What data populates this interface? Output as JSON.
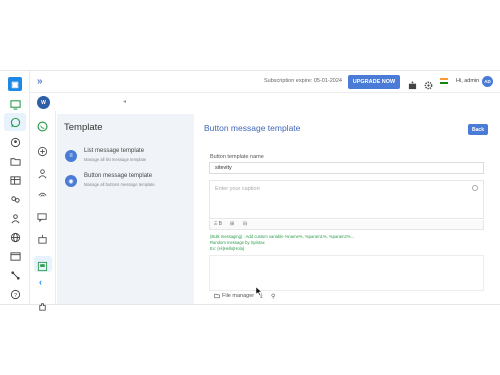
{
  "topbar": {
    "expand_icon": "»",
    "subscription": "Subscription expire: 05-01-2024",
    "upgrade_label": "UPGRADE NOW",
    "greeting": "Hi, admin",
    "avatar_initials": "AD"
  },
  "templates": {
    "title": "Template",
    "items": [
      {
        "label": "List message template",
        "sub": "Manage all list message template"
      },
      {
        "label": "Button message template",
        "sub": "Manage all buttons message template"
      }
    ]
  },
  "form": {
    "title": "Button message template",
    "back_label": "Back",
    "name_label": "Button template name",
    "name_value": "sitevity",
    "caption_placeholder": "Enter your caption",
    "toolbar": [
      "Ξ B",
      "⊞",
      "⊟"
    ],
    "hints": [
      "(Bulk messaging) : Add custom variable %name%, %param1%, %param2%...",
      "Random message by Spintax",
      "Ex: {Hi|Hello|Hola}"
    ],
    "file_manager_label": "File manager"
  },
  "colors": {
    "accent": "#4a7bd6",
    "hint_green": "#2e9c4f",
    "panel_bg": "#f0f4f8"
  }
}
